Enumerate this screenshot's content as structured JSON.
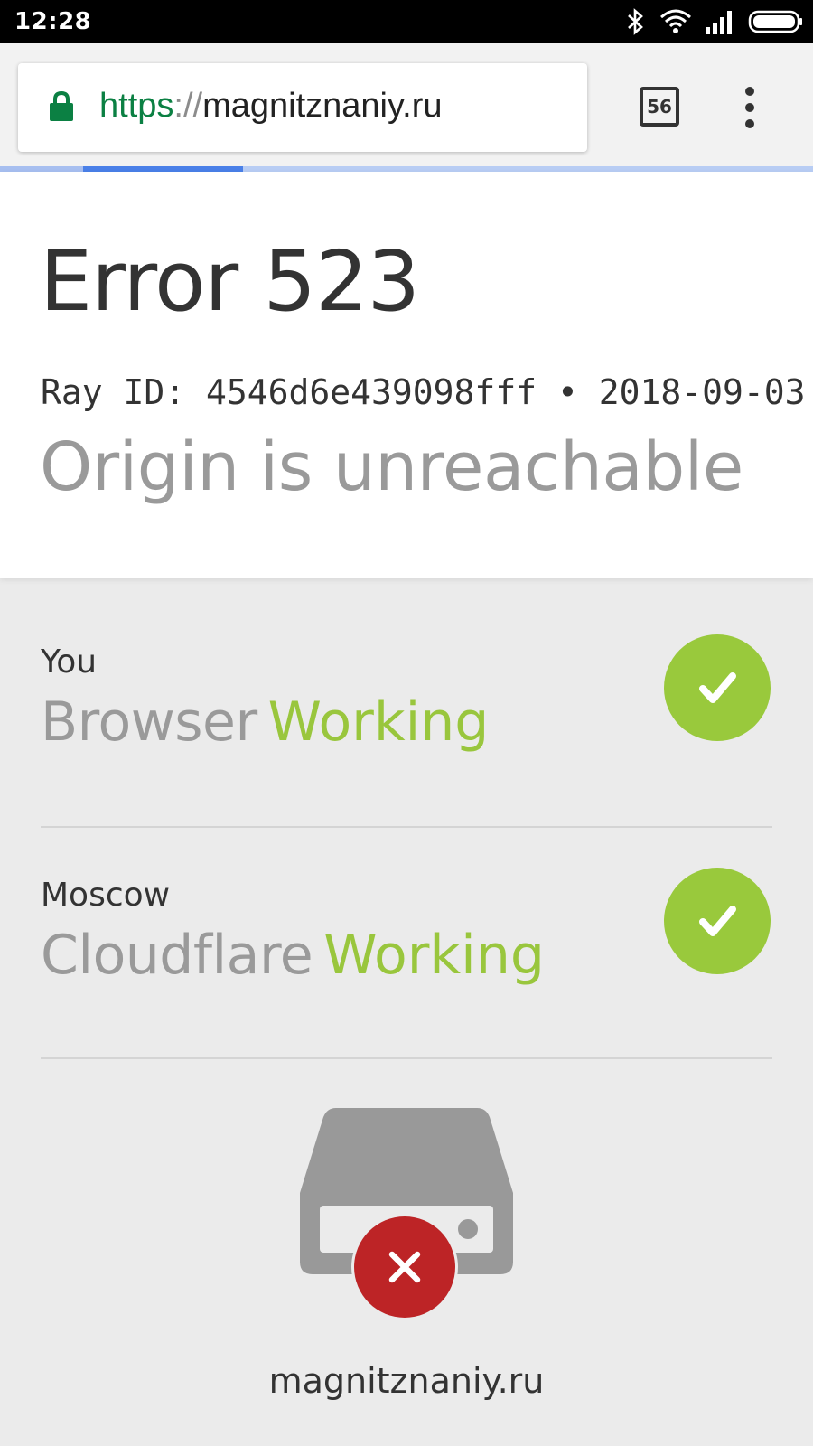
{
  "status_bar": {
    "time": "12:28",
    "icons": [
      "bluetooth-icon",
      "wifi-icon",
      "signal-icon",
      "battery-icon"
    ]
  },
  "browser": {
    "url_scheme": "https",
    "url_separator": "://",
    "url_host": "magnitznaniy.ru",
    "tab_count": "56",
    "icons": [
      "lock-icon",
      "tabs-icon",
      "more-vert-icon"
    ],
    "colors": {
      "scheme": "#0b8043",
      "progress": "#4a80e8"
    }
  },
  "page": {
    "title": "Error 523",
    "ray_id_line": "Ray ID: 4546d6e439098fff • 2018-09-03",
    "subtitle": "Origin is unreachable"
  },
  "status_rows": [
    {
      "location": "You",
      "name": "Browser",
      "state": "Working",
      "icon": "check-icon"
    },
    {
      "location": "Moscow",
      "name": "Cloudflare",
      "state": "Working",
      "icon": "check-icon"
    }
  ],
  "host_row": {
    "icon": "server-error-icon",
    "name": "magnitznaniy.ru"
  },
  "colors": {
    "working": "#99c63d",
    "error": "#bd2426",
    "muted_text": "#9a9a9a"
  }
}
